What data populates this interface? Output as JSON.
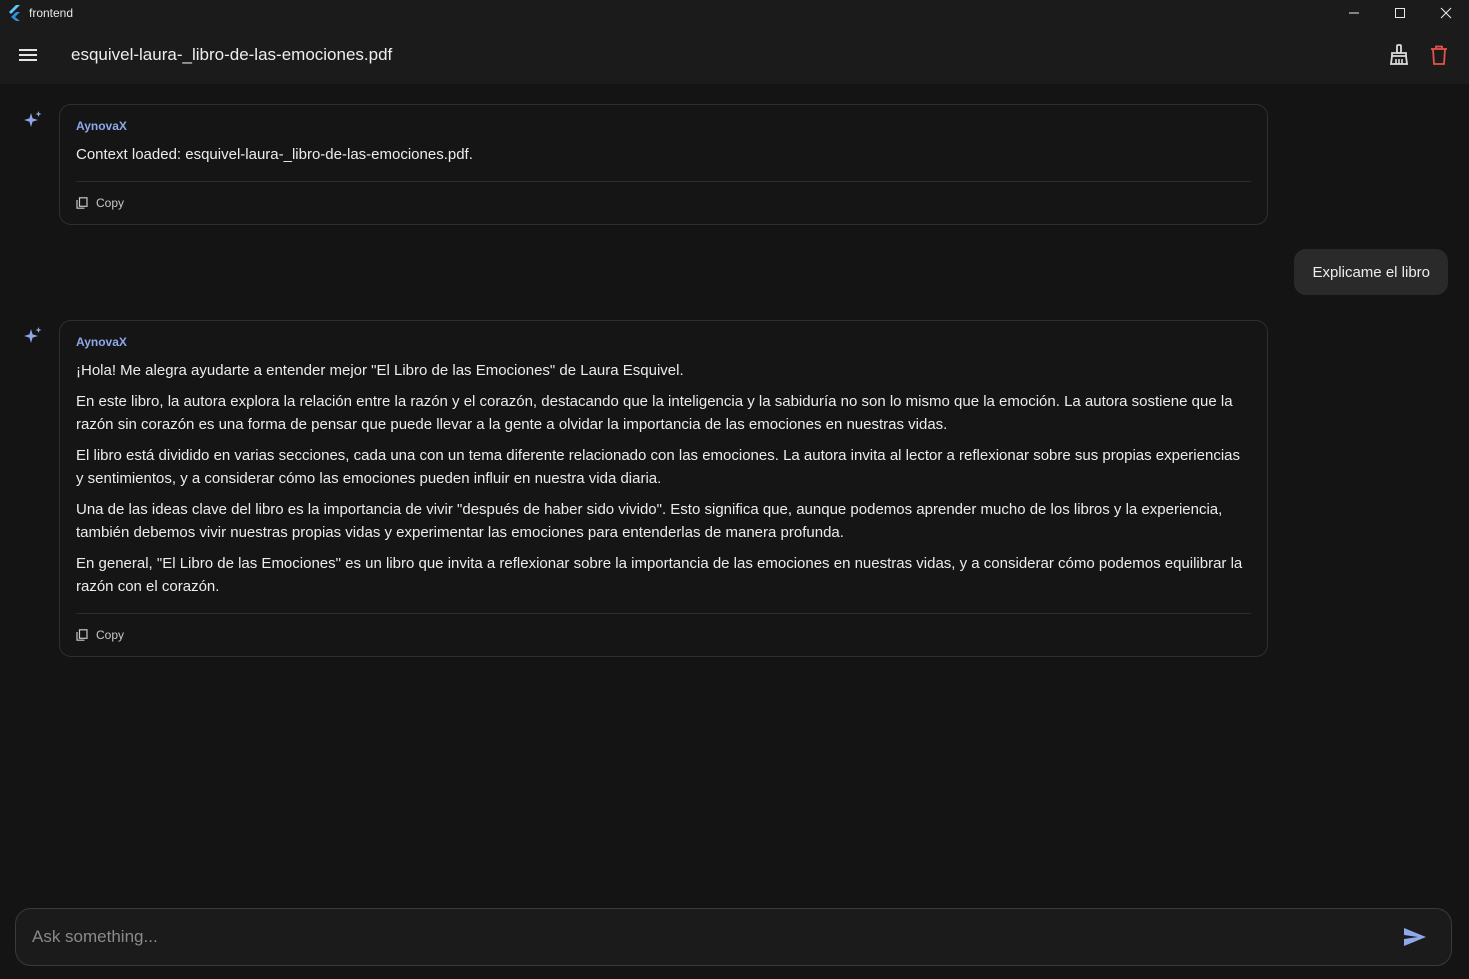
{
  "window": {
    "app_name": "frontend"
  },
  "appbar": {
    "title": "esquivel-laura-_libro-de-las-emociones.pdf"
  },
  "messages": [
    {
      "role": "assistant",
      "sender": "AynovaX",
      "paragraphs": [
        "Context loaded: esquivel-laura-_libro-de-las-emociones.pdf."
      ],
      "copy_label": "Copy"
    },
    {
      "role": "user",
      "text": "Explicame el libro"
    },
    {
      "role": "assistant",
      "sender": "AynovaX",
      "paragraphs": [
        "¡Hola! Me alegra ayudarte a entender mejor \"El Libro de las Emociones\" de Laura Esquivel.",
        "En este libro, la autora explora la relación entre la razón y el corazón, destacando que la inteligencia y la sabiduría no son lo mismo que la emoción. La autora sostiene que la razón sin corazón es una forma de pensar que puede llevar a la gente a olvidar la importancia de las emociones en nuestras vidas.",
        "El libro está dividido en varias secciones, cada una con un tema diferente relacionado con las emociones. La autora invita al lector a reflexionar sobre sus propias experiencias y sentimientos, y a considerar cómo las emociones pueden influir en nuestra vida diaria.",
        "Una de las ideas clave del libro es la importancia de vivir \"después de haber sido vivido\". Esto significa que, aunque podemos aprender mucho de los libros y la experiencia, también debemos vivir nuestras propias vidas y experimentar las emociones para entenderlas de manera profunda.",
        "En general, \"El Libro de las Emociones\" es un libro que invita a reflexionar sobre la importancia de las emociones en nuestras vidas, y a considerar cómo podemos equilibrar la razón con el corazón."
      ],
      "copy_label": "Copy"
    }
  ],
  "input": {
    "placeholder": "Ask something...",
    "value": ""
  },
  "icons": {
    "app": "flutter-logo-icon",
    "menu": "hamburger-menu-icon",
    "clear": "broom-icon",
    "delete": "trash-icon",
    "assistant": "sparkle-icon",
    "copy": "copy-icon",
    "send": "send-icon"
  },
  "colors": {
    "background": "#141414",
    "bar": "#1b1b1b",
    "accent": "#8ea8ea",
    "delete": "#e5534b",
    "user_bubble": "#2a2a2a"
  }
}
